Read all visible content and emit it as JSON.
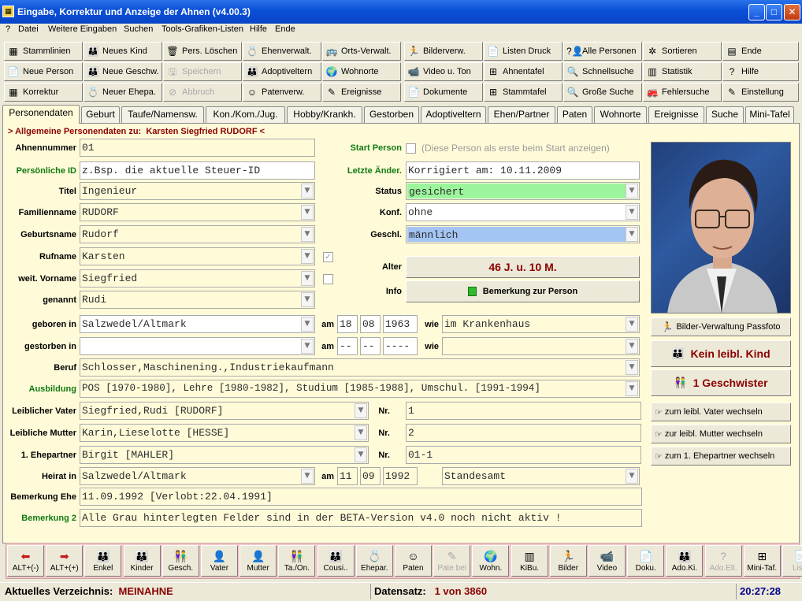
{
  "window": {
    "title": "Eingabe, Korrektur und Anzeige der Ahnen (v4.00.3)",
    "min": "_",
    "max": "□",
    "close": "✕"
  },
  "menu": [
    "?",
    "Datei",
    "Weitere Eingaben",
    "Suchen",
    "Tools-Grafiken-Listen",
    "Hilfe",
    "Ende"
  ],
  "toolbar": [
    [
      {
        "label": "Stammlinien",
        "icon": "▦"
      },
      {
        "label": "Neues Kind",
        "icon": "👪"
      },
      {
        "label": "Pers. Löschen",
        "icon": "🗑"
      },
      {
        "label": "Ehenverwalt.",
        "icon": "💍"
      },
      {
        "label": "Orts-Verwalt.",
        "icon": "🚌"
      },
      {
        "label": "Bilderverw.",
        "icon": "🏃"
      },
      {
        "label": "Listen Druck",
        "icon": "📄"
      },
      {
        "label": "Alle Personen",
        "icon": "?👤"
      },
      {
        "label": "Sortieren",
        "icon": "✲"
      },
      {
        "label": "Ende",
        "icon": "▤"
      }
    ],
    [
      {
        "label": "Neue Person",
        "icon": "📄"
      },
      {
        "label": "Neue Geschw.",
        "icon": "👪"
      },
      {
        "label": "Speichern",
        "icon": "🖫",
        "disabled": true
      },
      {
        "label": "Adoptiveltern",
        "icon": "👪"
      },
      {
        "label": "Wohnorte",
        "icon": "🌍"
      },
      {
        "label": "Video u. Ton",
        "icon": "📹"
      },
      {
        "label": "Ahnentafel",
        "icon": "⊞"
      },
      {
        "label": "Schnellsuche",
        "icon": "🔍"
      },
      {
        "label": "Statistik",
        "icon": "▥"
      },
      {
        "label": "Hilfe",
        "icon": "?"
      }
    ],
    [
      {
        "label": "Korrektur",
        "icon": "▦"
      },
      {
        "label": "Neuer Ehepa.",
        "icon": "💍"
      },
      {
        "label": "Abbruch",
        "icon": "⊘",
        "disabled": true
      },
      {
        "label": "Patenverw.",
        "icon": "☺"
      },
      {
        "label": "Ereignisse",
        "icon": "✎"
      },
      {
        "label": "Dokumente",
        "icon": "📄"
      },
      {
        "label": "Stammtafel",
        "icon": "⊞"
      },
      {
        "label": "Große Suche",
        "icon": "🔍"
      },
      {
        "label": "Fehlersuche",
        "icon": "🚒"
      },
      {
        "label": "Einstellung",
        "icon": "✎"
      }
    ]
  ],
  "tabs": [
    "Personendaten",
    "Geburt",
    "Taufe/Namensw.",
    "Kon./Kom./Jug.",
    "Hobby/Krankh.",
    "Gestorben",
    "Adoptiveltern",
    "Ehen/Partner",
    "Paten",
    "Wohnorte",
    "Ereignisse",
    "Suche",
    "Mini-Tafel"
  ],
  "panel_title_prefix": "> Allgemeine Personendaten zu:",
  "panel_title_name": "Karsten Siegfried RUDORF",
  "panel_title_suffix": "<",
  "fields": {
    "ahnennummer": {
      "label": "Ahnennummer",
      "value": "01"
    },
    "pid": {
      "label": "Persönliche ID",
      "value": "z.Bsp. die aktuelle Steuer-ID"
    },
    "titel": {
      "label": "Titel",
      "value": "Ingenieur"
    },
    "familienname": {
      "label": "Familienname",
      "value": "RUDORF"
    },
    "geburtsname": {
      "label": "Geburtsname",
      "value": "Rudorf"
    },
    "rufname": {
      "label": "Rufname",
      "value": "Karsten"
    },
    "weitvorname": {
      "label": "weit. Vorname",
      "value": "Siegfried"
    },
    "genannt": {
      "label": "genannt",
      "value": "Rudi"
    },
    "geboren": {
      "label": "geboren in",
      "value": "Salzwedel/Altmark",
      "am": "am",
      "day": "18",
      "month": "08",
      "year": "1963",
      "wie": "wie",
      "wie_value": "im Krankenhaus"
    },
    "gestorben": {
      "label": "gestorben in",
      "value": "",
      "am": "am",
      "day": "--",
      "month": "--",
      "year": "----",
      "wie": "wie",
      "wie_value": ""
    },
    "beruf": {
      "label": "Beruf",
      "value": "Schlosser,Maschinening.,Industriekaufmann"
    },
    "ausbildung": {
      "label": "Ausbildung",
      "value": "POS [1970-1980], Lehre [1980-1982], Studium [1985-1988], Umschul. [1991-1994]"
    },
    "vater": {
      "label": "Leiblicher Vater",
      "value": "Siegfried,Rudi [RUDORF]",
      "nr_label": "Nr.",
      "nr": "1"
    },
    "mutter": {
      "label": "Leibliche Mutter",
      "value": "Karin,Lieselotte [HESSE]",
      "nr_label": "Nr.",
      "nr": "2"
    },
    "ehepartner": {
      "label": "1. Ehepartner",
      "value": "Birgit [MAHLER]",
      "nr_label": "Nr.",
      "nr": "01-1"
    },
    "heirat": {
      "label": "Heirat in",
      "value": "Salzwedel/Altmark",
      "am": "am",
      "day": "11",
      "month": "09",
      "year": "1992",
      "wie_value": "Standesamt"
    },
    "bem_ehe": {
      "label": "Bemerkung Ehe",
      "value": "11.09.1992 [Verlobt:22.04.1991]"
    },
    "bem2": {
      "label": "Bemerkung 2",
      "value": "Alle Grau hinterlegten Felder sind in der BETA-Version v4.0 noch nicht aktiv !"
    }
  },
  "right": {
    "start_label": "Start Person",
    "start_hint": "(Diese Person als erste beim Start anzeigen)",
    "letzte_label": "Letzte Änder.",
    "letzte_value": "Korrigiert am: 10.11.2009",
    "status_label": "Status",
    "status_value": "gesichert",
    "status_color": "#9cf59c",
    "konf_label": "Konf.",
    "konf_value": "ohne",
    "geschl_label": "Geschl.",
    "geschl_value": "männlich",
    "geschl_color": "#a4c4f4",
    "alter_label": "Alter",
    "alter_value": "46 J. u. 10 M.",
    "info_label": "Info",
    "info_button": "Bemerkung zur Person"
  },
  "side": {
    "passfoto": "Bilder-Verwaltung Passfoto",
    "kinder": "Kein leibl. Kind",
    "geschwister": "1 Geschwister",
    "zum_vater": "zum leibl. Vater wechseln",
    "zur_mutter": "zur leibl. Mutter wechseln",
    "zum_partner": "zum 1. Ehepartner wechseln"
  },
  "nav": [
    {
      "label": "ALT+(-)",
      "icon": "⬅"
    },
    {
      "label": "ALT+(+)",
      "icon": "➡"
    },
    {
      "label": "Enkel",
      "icon": "👪"
    },
    {
      "label": "Kinder",
      "icon": "👪"
    },
    {
      "label": "Gesch.",
      "icon": "👫"
    },
    {
      "label": "Vater",
      "icon": "👤"
    },
    {
      "label": "Mutter",
      "icon": "👤"
    },
    {
      "label": "Ta./On.",
      "icon": "👫"
    },
    {
      "label": "Cousi..",
      "icon": "👪"
    },
    {
      "label": "Ehepar.",
      "icon": "💍"
    },
    {
      "label": "Paten",
      "icon": "☺"
    },
    {
      "label": "Pate bei",
      "icon": "✎",
      "disabled": true
    },
    {
      "label": "Wohn.",
      "icon": "🌍"
    },
    {
      "label": "KiBu.",
      "icon": "▥"
    },
    {
      "label": "Bilder",
      "icon": "🏃"
    },
    {
      "label": "Video",
      "icon": "📹"
    },
    {
      "label": "Doku.",
      "icon": "📄"
    },
    {
      "label": "Ado.Ki.",
      "icon": "👪"
    },
    {
      "label": "Ado.Elt.",
      "icon": "?",
      "disabled": true
    },
    {
      "label": "Mini-Taf.",
      "icon": "⊞"
    },
    {
      "label": "Liste",
      "icon": "📄",
      "disabled": true
    }
  ],
  "status": {
    "verz_label": "Aktuelles Verzeichnis:",
    "verz_value": "MEINAHNE",
    "ds_label": "Datensatz:",
    "ds_value": "1 von 3860",
    "time": "20:27:28"
  }
}
